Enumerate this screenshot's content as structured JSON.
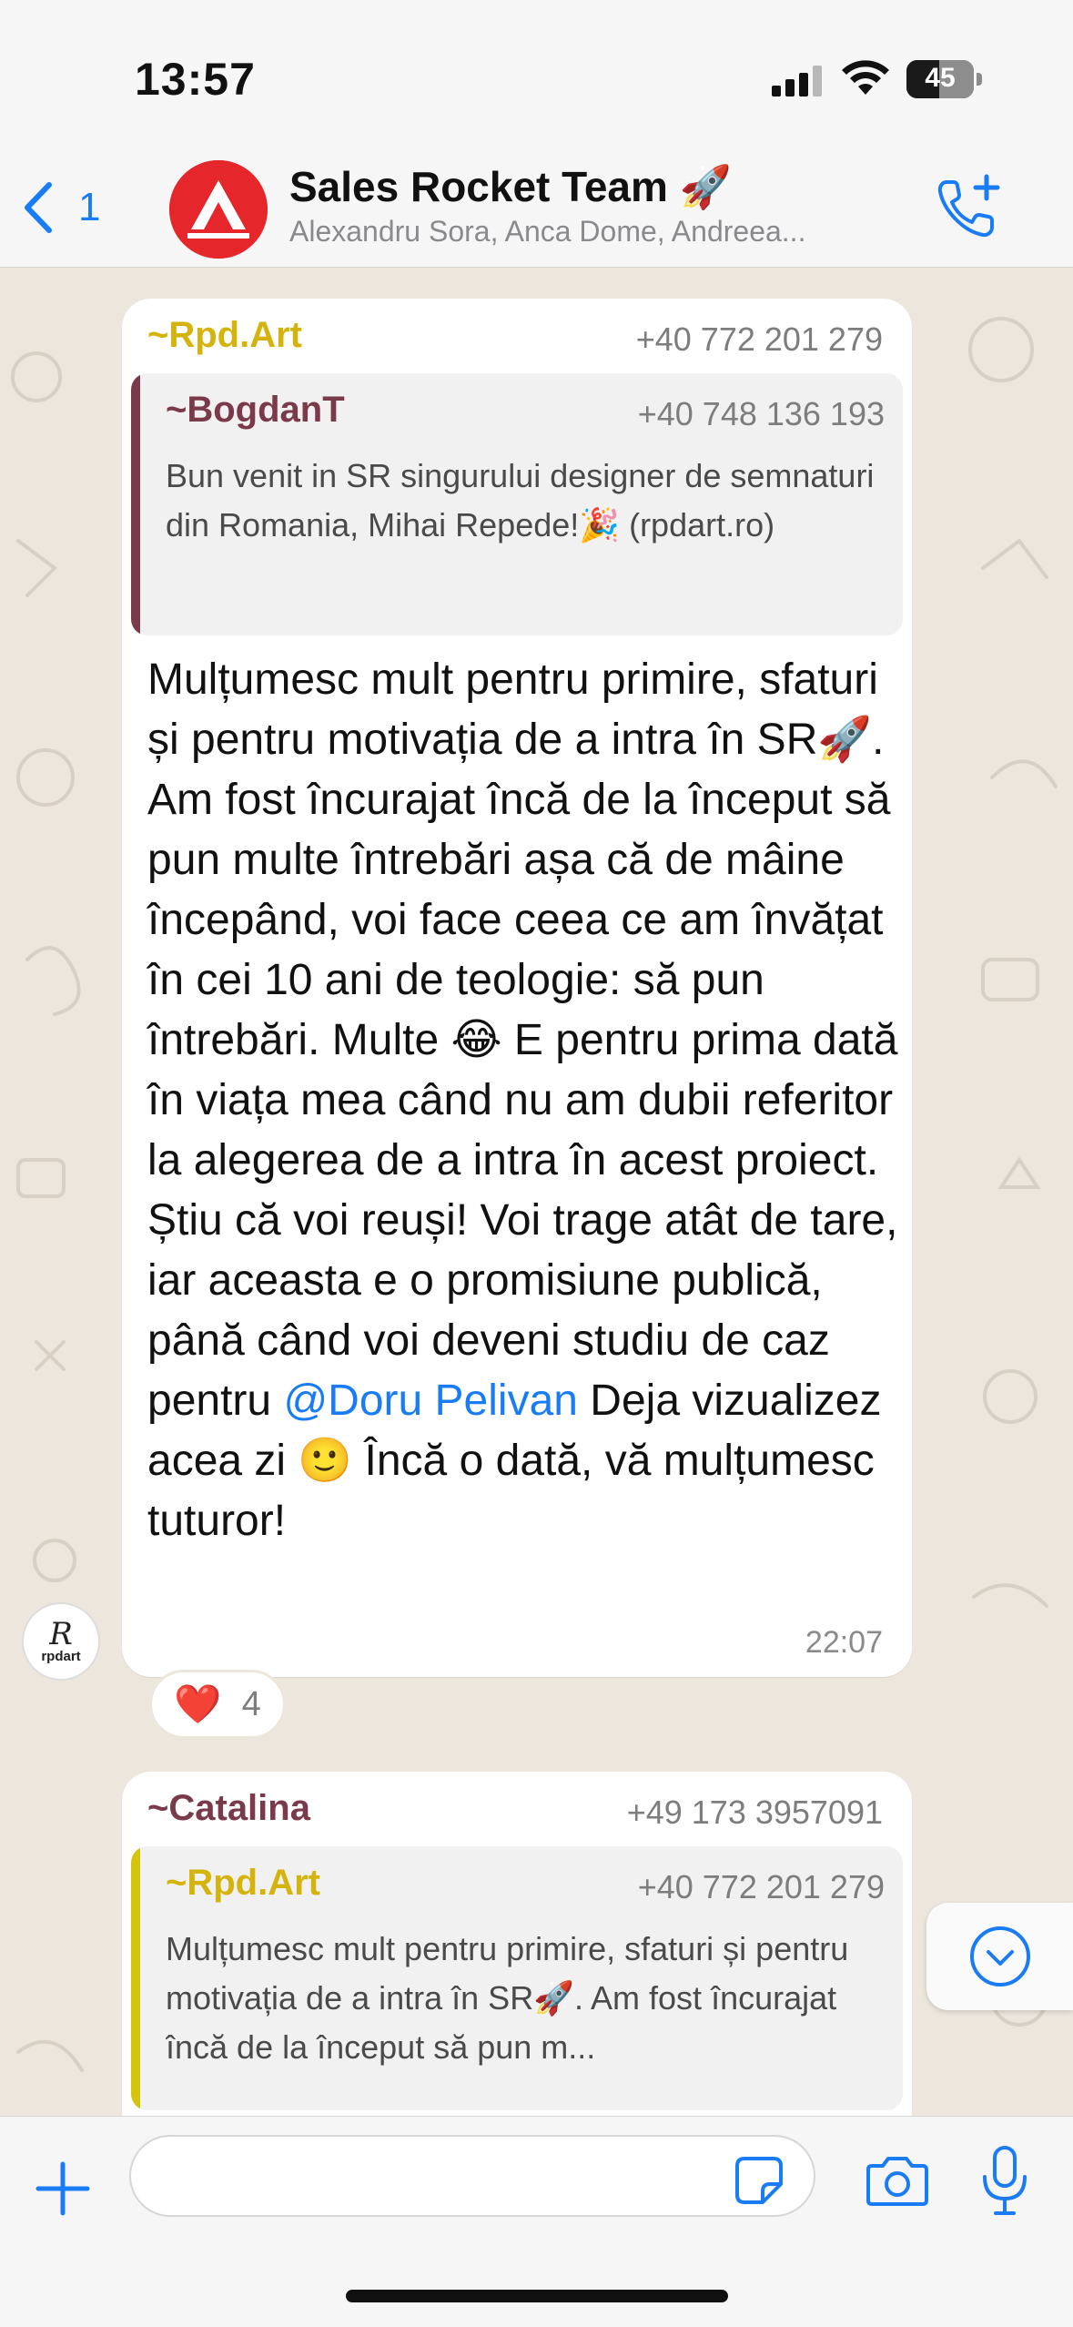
{
  "status": {
    "time": "13:57",
    "battery": "45"
  },
  "header": {
    "back_count": "1",
    "group_name": "Sales Rocket Team 🚀",
    "members": "Alexandru Sora, Anca Dome, Andreea..."
  },
  "messages": [
    {
      "sender": "~Rpd.Art",
      "phone": "+40 772 201 279",
      "quote": {
        "sender": "~BogdanT",
        "phone": "+40 748 136 193",
        "text": "Bun venit in SR singurului designer de semnaturi din Romania, Mihai Repede!🎉 (rpdart.ro)"
      },
      "text_before_mention": "Mulțumesc mult pentru primire, sfaturi și pentru motivația de a intra în SR🚀. Am fost încurajat încă de la început să pun multe întrebări așa că de mâine începând, voi face ceea ce am învățat în cei 10 ani de teologie: să pun întrebări. Multe 😂 E pentru prima dată în viața mea când nu am dubii referitor la alegerea de a intra în acest proiect. Știu că voi reuși! Voi trage atât de tare, iar aceasta e o promisiune publică, până când voi deveni studiu de caz pentru ",
      "mention": "@Doru Pelivan",
      "text_after_mention": " Deja vizualizez acea zi 🙂 Încă o dată, vă mulțumesc tuturor!",
      "time": "22:07",
      "reaction": {
        "emoji": "❤️",
        "count": "4"
      },
      "avatar_text": "rpdart"
    },
    {
      "sender": "~Catalina",
      "phone": "+49 173 3957091",
      "quote": {
        "sender": "~Rpd.Art",
        "phone": "+40 772 201 279",
        "text": "Mulțumesc mult pentru primire, sfaturi și pentru motivația de a intra în SR🚀. Am fost încurajat încă de la început să pun m..."
      }
    }
  ],
  "input": {
    "value": ""
  },
  "colors": {
    "sender_rpd": "#d4b40c",
    "sender_bogdan": "#7a3a4a",
    "sender_catalina": "#7a3a4a",
    "accent": "#1a7cf5",
    "group_avatar": "#e5262b"
  }
}
